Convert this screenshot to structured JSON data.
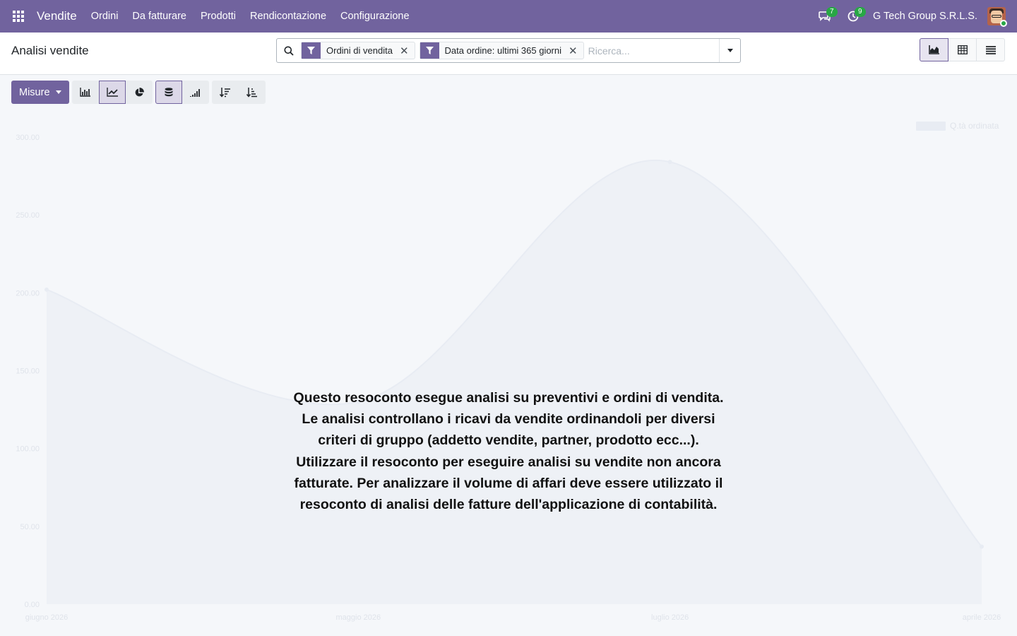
{
  "navbar": {
    "app_name": "Vendite",
    "menu": [
      "Ordini",
      "Da fatturare",
      "Prodotti",
      "Rendicontazione",
      "Configurazione"
    ],
    "messages_count": "7",
    "activities_count": "9",
    "company": "G Tech Group S.R.L.S.",
    "accent_color": "#71639e",
    "status_color": "#28a745"
  },
  "control_panel": {
    "title": "Analisi vendite",
    "search": {
      "facets": [
        {
          "label": "Ordini di vendita",
          "icon": "filter-icon"
        },
        {
          "label": "Data ordine: ultimi 365 giorni",
          "icon": "filter-icon"
        }
      ],
      "placeholder": "Ricerca..."
    },
    "views": [
      {
        "name": "graph",
        "icon": "area-chart-icon",
        "active": true
      },
      {
        "name": "pivot",
        "icon": "table-icon",
        "active": false
      },
      {
        "name": "list",
        "icon": "list-icon",
        "active": false
      }
    ]
  },
  "toolbar": {
    "measures_label": "Misure",
    "chart_types": [
      {
        "name": "bar",
        "icon": "bar-chart-icon",
        "active": false
      },
      {
        "name": "line",
        "icon": "line-chart-icon",
        "active": true
      },
      {
        "name": "pie",
        "icon": "pie-chart-icon",
        "active": false
      }
    ],
    "options": [
      {
        "name": "stacked",
        "icon": "database-icon",
        "active": true
      },
      {
        "name": "cumulative",
        "icon": "signal-icon",
        "active": false
      }
    ],
    "sort": [
      {
        "name": "descending",
        "icon": "sort-desc-icon"
      },
      {
        "name": "ascending",
        "icon": "sort-asc-icon"
      }
    ]
  },
  "help_text": "Questo resoconto esegue analisi su preventivi e ordini di vendita. Le analisi controllano i ricavi da vendite ordinandoli per diversi criteri di gruppo (addetto vendite, partner, prodotto ecc...). Utilizzare il resoconto per eseguire analisi su vendite non ancora fatturate. Per analizzare il volume di affari deve essere utilizzato il resoconto di analisi delle fatture dell'applicazione di contabilità.",
  "chart_data": {
    "type": "area",
    "categories": [
      "giugno 2026",
      "maggio 2026",
      "luglio 2026",
      "aprile 2026"
    ],
    "series": [
      {
        "name": "Q.tà ordinata",
        "values": [
          202,
          130,
          284,
          37
        ]
      }
    ],
    "y_ticks": [
      "0.00",
      "50.00",
      "100.00",
      "150.00",
      "200.00",
      "250.00",
      "300.00"
    ],
    "ylim": [
      0,
      300
    ],
    "legend": "top-right",
    "grid": false,
    "series_color": "#e8ecf3"
  }
}
